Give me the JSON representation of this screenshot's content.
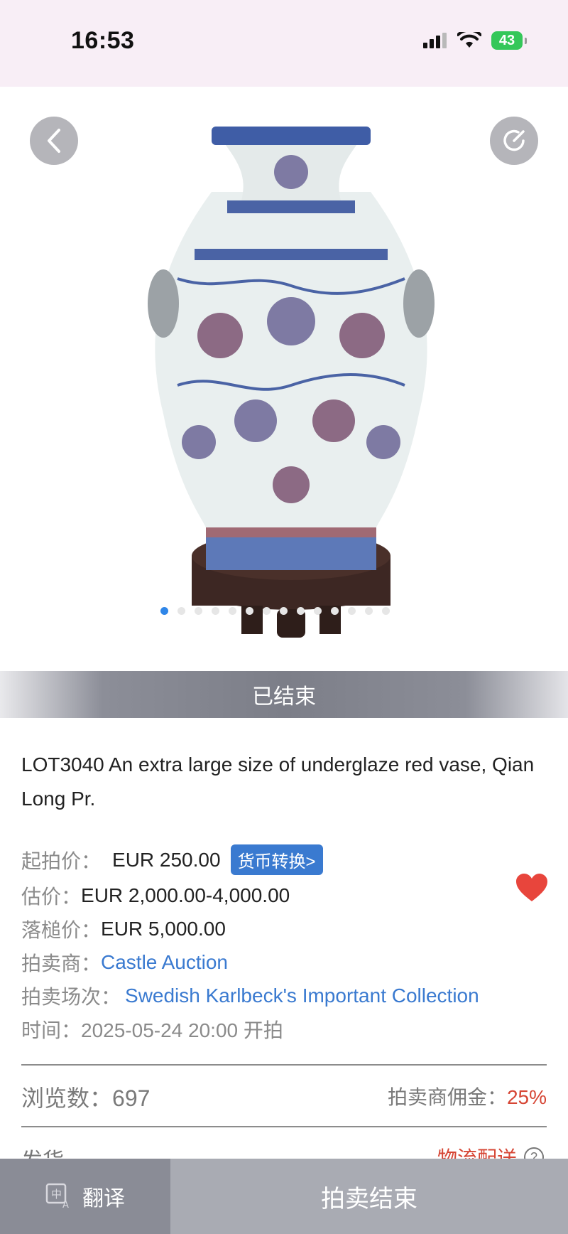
{
  "status_bar": {
    "time": "16:53",
    "battery": "43"
  },
  "gallery": {
    "dot_count": 14,
    "active_dot": 0
  },
  "status_banner": "已结束",
  "lot": {
    "title": "LOT3040 An extra large size of underglaze red vase, Qian Long Pr.",
    "start_price_label": "起拍价：",
    "start_price": "EUR 250.00",
    "convert_label": "货币转换>",
    "estimate_label": "估价：",
    "estimate": "EUR 2,000.00-4,000.00",
    "hammer_label": "落槌价：",
    "hammer_price": "EUR 5,000.00",
    "auctioneer_label": "拍卖商：",
    "auctioneer": "Castle Auction",
    "session_label": "拍卖场次：",
    "session": "Swedish Karlbeck's Important Collection",
    "time_label": "时间：",
    "time": "2025-05-24 20:00 开拍"
  },
  "stats": {
    "views_label": "浏览数：",
    "views": "697",
    "commission_label": "拍卖商佣金：",
    "commission": "25%"
  },
  "shipping": {
    "label": "发货",
    "method": "物流配送",
    "help": "?"
  },
  "bottom_bar": {
    "translate": "翻译",
    "action": "拍卖结束"
  },
  "colors": {
    "accent_blue": "#3a7ad0",
    "accent_red": "#d64534",
    "favorite_red": "#e8453c"
  }
}
